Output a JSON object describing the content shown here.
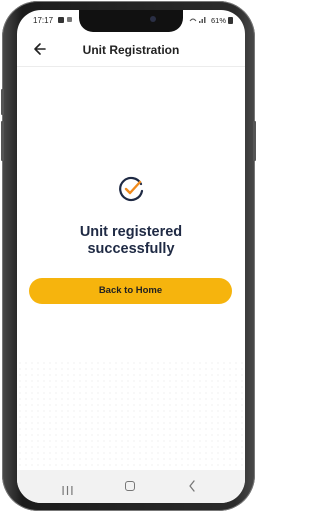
{
  "status_bar": {
    "time": "17:17",
    "battery": "61%"
  },
  "header": {
    "title": "Unit Registration"
  },
  "content": {
    "message_line1": "Unit registered",
    "message_line2": "successfully",
    "button_label": "Back to Home"
  },
  "colors": {
    "accent": "#f6b40d",
    "check_dark": "#1f2a44",
    "check_accent": "#f08a1c",
    "text_dark": "#1f2a44"
  },
  "icons": {
    "back": "arrow-left-icon",
    "success": "check-circle-icon",
    "nav_recents": "recents-icon",
    "nav_home": "home-icon",
    "nav_back": "chevron-left-icon"
  }
}
